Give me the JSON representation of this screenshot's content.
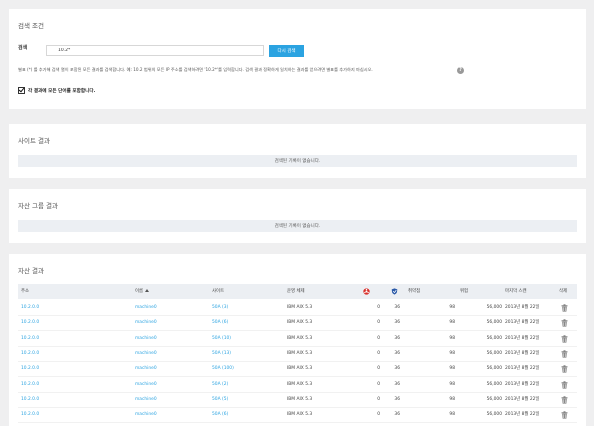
{
  "search_panel": {
    "title": "검색 조건",
    "label": "검색",
    "input_value": "10.2*",
    "button_label": "다시 검색",
    "hint": "별표 (*) 를 추가해 검색 열이 포함된 모든 결과를 검색합니다. 예: 10.2 범위의 모든 IP 주소를 검색하려면 '10.2*'를 입력합니다. 검색 결과 정확하게 일치하는 결과를 얻으려면 별표를 추가하지 마십시오.",
    "checkbox_label": "각 결과에 모든 단어를 포함합니다."
  },
  "site_panel": {
    "title": "사이트 결과",
    "empty": "검색된 기록이 없습니다."
  },
  "group_panel": {
    "title": "자산 그룹 결과",
    "empty": "검색된 기록이 없습니다."
  },
  "asset_panel": {
    "title": "자산 결과",
    "columns": {
      "address": "주소",
      "name": "이름",
      "site": "사이트",
      "os": "운영 체제",
      "vuln": "취약점",
      "risk": "위험",
      "last_scan": "마지막 스캔",
      "delete": "삭제"
    },
    "rows": [
      {
        "address": "10.2.0.0",
        "name": "machine0",
        "site": "50A (3)",
        "os": "IBM AIX 5.3",
        "malware": "0",
        "exploit": "36",
        "vuln": "98",
        "risk": "56,000",
        "scan": "2013년 8월 22일"
      },
      {
        "address": "10.2.0.0",
        "name": "machine0",
        "site": "50A (6)",
        "os": "IBM AIX 5.3",
        "malware": "0",
        "exploit": "36",
        "vuln": "98",
        "risk": "56,000",
        "scan": "2013년 8월 22일"
      },
      {
        "address": "10.2.0.0",
        "name": "machine0",
        "site": "50A (10)",
        "os": "IBM AIX 5.3",
        "malware": "0",
        "exploit": "36",
        "vuln": "98",
        "risk": "56,000",
        "scan": "2013년 8월 22일"
      },
      {
        "address": "10.2.0.0",
        "name": "machine0",
        "site": "50A (13)",
        "os": "IBM AIX 5.3",
        "malware": "0",
        "exploit": "36",
        "vuln": "98",
        "risk": "56,000",
        "scan": "2013년 8월 22일"
      },
      {
        "address": "10.2.0.0",
        "name": "machine0",
        "site": "50A (100)",
        "os": "IBM AIX 5.3",
        "malware": "0",
        "exploit": "36",
        "vuln": "98",
        "risk": "56,000",
        "scan": "2013년 8월 22일"
      },
      {
        "address": "10.2.0.0",
        "name": "machine0",
        "site": "50A (2)",
        "os": "IBM AIX 5.3",
        "malware": "0",
        "exploit": "36",
        "vuln": "98",
        "risk": "56,000",
        "scan": "2013년 8월 22일"
      },
      {
        "address": "10.2.0.0",
        "name": "machine0",
        "site": "50A (5)",
        "os": "IBM AIX 5.3",
        "malware": "0",
        "exploit": "36",
        "vuln": "98",
        "risk": "56,000",
        "scan": "2013년 8월 22일"
      },
      {
        "address": "10.2.0.0",
        "name": "machine0",
        "site": "50A (6)",
        "os": "IBM AIX 5.3",
        "malware": "0",
        "exploit": "36",
        "vuln": "98",
        "risk": "56,000",
        "scan": "2013년 8월 22일"
      }
    ]
  },
  "icons": {
    "malware": "biohazard-icon",
    "exploit": "shield-icon",
    "delete": "trash-icon",
    "help": "help-icon"
  },
  "colors": {
    "accent": "#2ba3e1",
    "malware": "#d9302b",
    "exploit": "#2b5aa8"
  }
}
